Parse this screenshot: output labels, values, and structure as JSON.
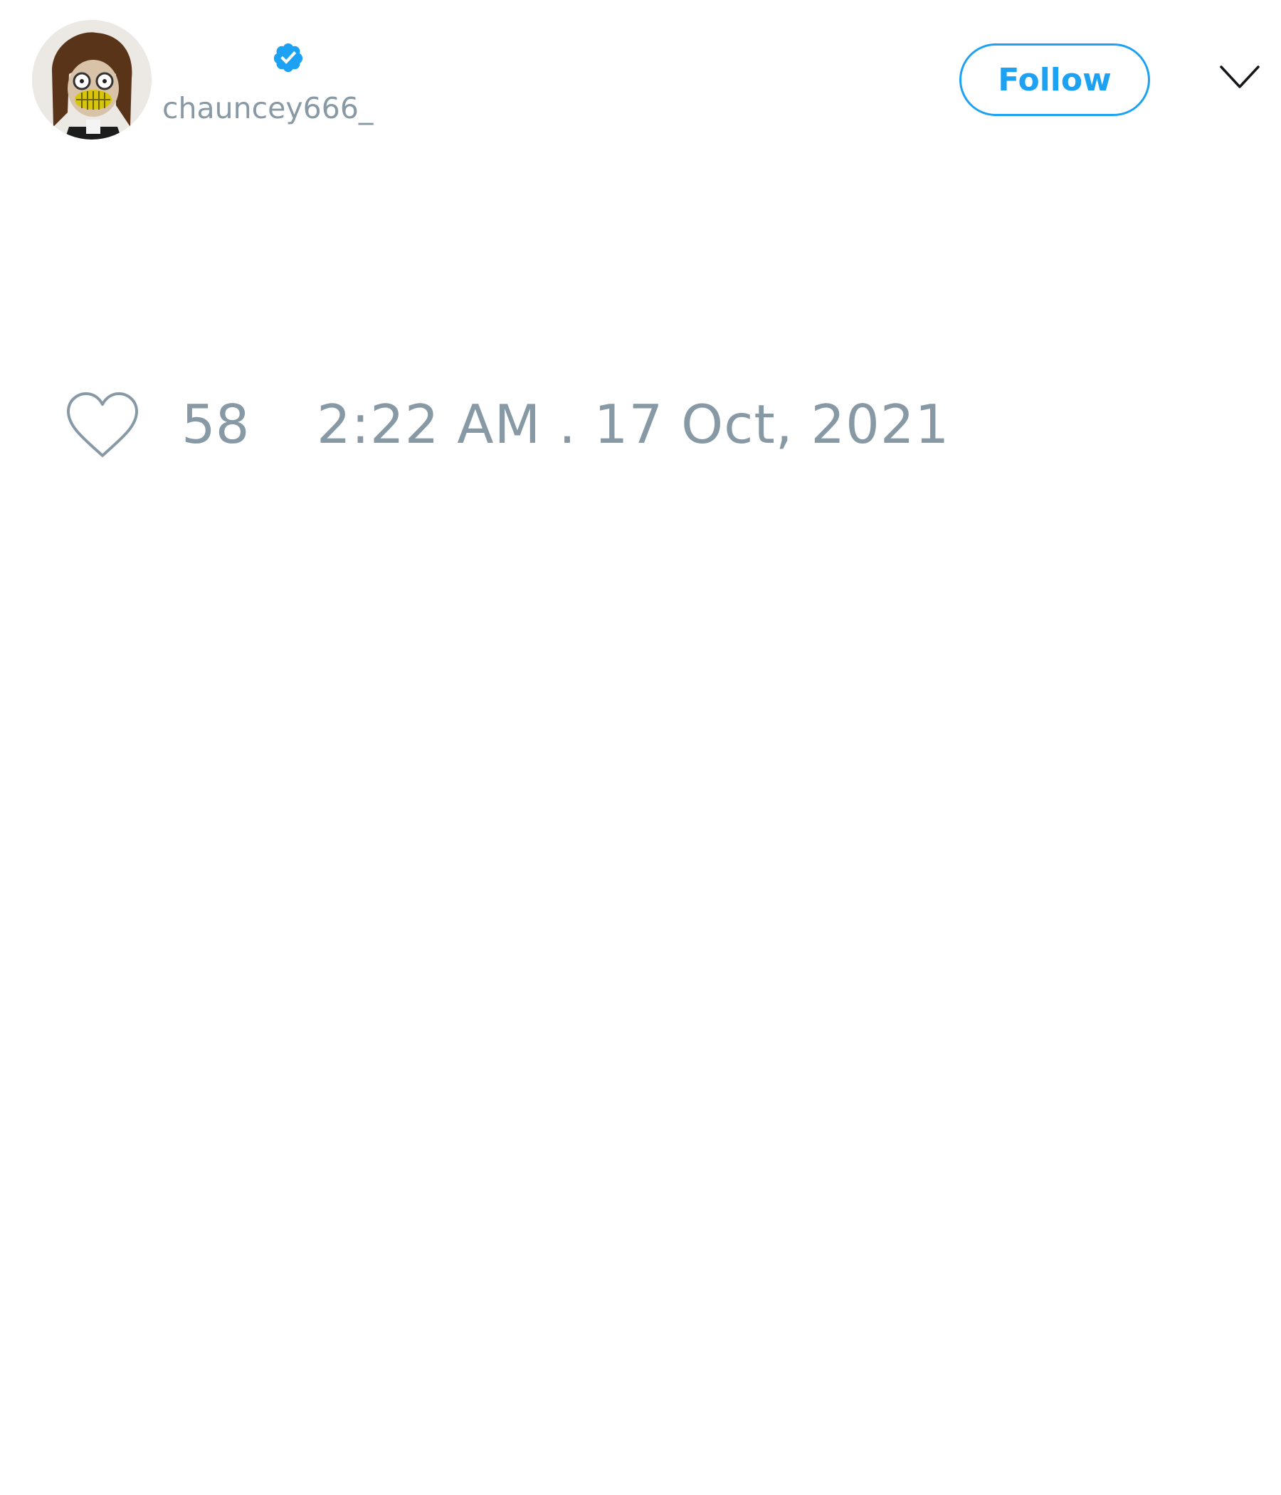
{
  "tweet": {
    "author": {
      "display_name": "",
      "handle": "chauncey666_",
      "verified": true,
      "avatar_icon": "cartoon-avatar"
    },
    "actions": {
      "follow_label": "Follow",
      "menu_icon": "chevron-down-icon"
    },
    "stats": {
      "like_icon": "heart-outline-icon",
      "like_count": "58",
      "timestamp": "2:22 AM . 17 Oct, 2021"
    }
  },
  "colors": {
    "accent": "#1da1f2",
    "muted_text": "#8899a6",
    "background": "#ffffff"
  }
}
